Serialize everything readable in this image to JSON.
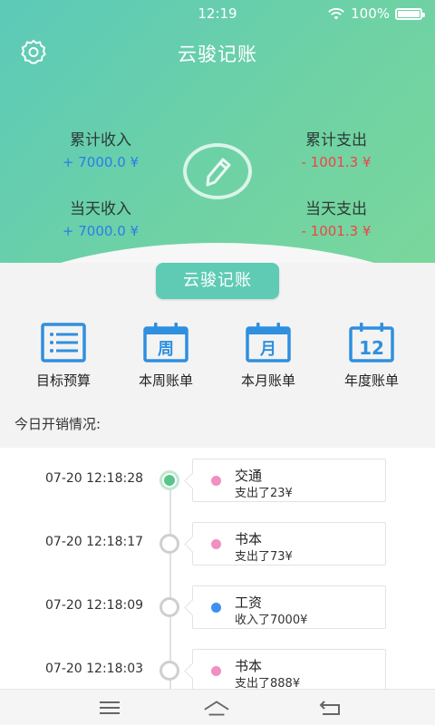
{
  "status": {
    "time": "12:19",
    "battery": "100%"
  },
  "header": {
    "title": "云骏记账",
    "stats": [
      {
        "label": "累计收入",
        "value": "+ 7000.0 ¥",
        "kind": "pos"
      },
      {
        "label": "累计支出",
        "value": "- 1001.3 ¥",
        "kind": "neg"
      },
      {
        "label": "当天收入",
        "value": "+ 7000.0 ¥",
        "kind": "pos"
      },
      {
        "label": "当天支出",
        "value": "- 1001.3 ¥",
        "kind": "neg"
      }
    ]
  },
  "main_button": "云骏记账",
  "grid": [
    {
      "label": "目标预算",
      "icon": "list-icon"
    },
    {
      "label": "本周账单",
      "icon": "calendar-week-icon",
      "glyph": "周"
    },
    {
      "label": "本月账单",
      "icon": "calendar-month-icon",
      "glyph": "月"
    },
    {
      "label": "年度账单",
      "icon": "calendar-year-icon",
      "glyph": "12"
    }
  ],
  "section_title": "今日开销情况:",
  "records": [
    {
      "time": "07-20 12:18:28",
      "category": "交通",
      "desc": "支出了23¥",
      "color": "#f08fc0",
      "active": true
    },
    {
      "time": "07-20 12:18:17",
      "category": "书本",
      "desc": "支出了73¥",
      "color": "#f08fc0",
      "active": false
    },
    {
      "time": "07-20 12:18:09",
      "category": "工资",
      "desc": "收入了7000¥",
      "color": "#3d8ff0",
      "active": false
    },
    {
      "time": "07-20 12:18:03",
      "category": "书本",
      "desc": "支出了888¥",
      "color": "#f08fc0",
      "active": false
    }
  ],
  "colors": {
    "accent": "#5fcbb4",
    "positive": "#2b7de9",
    "negative": "#ef4444",
    "icon_blue": "#2f8fe0"
  }
}
